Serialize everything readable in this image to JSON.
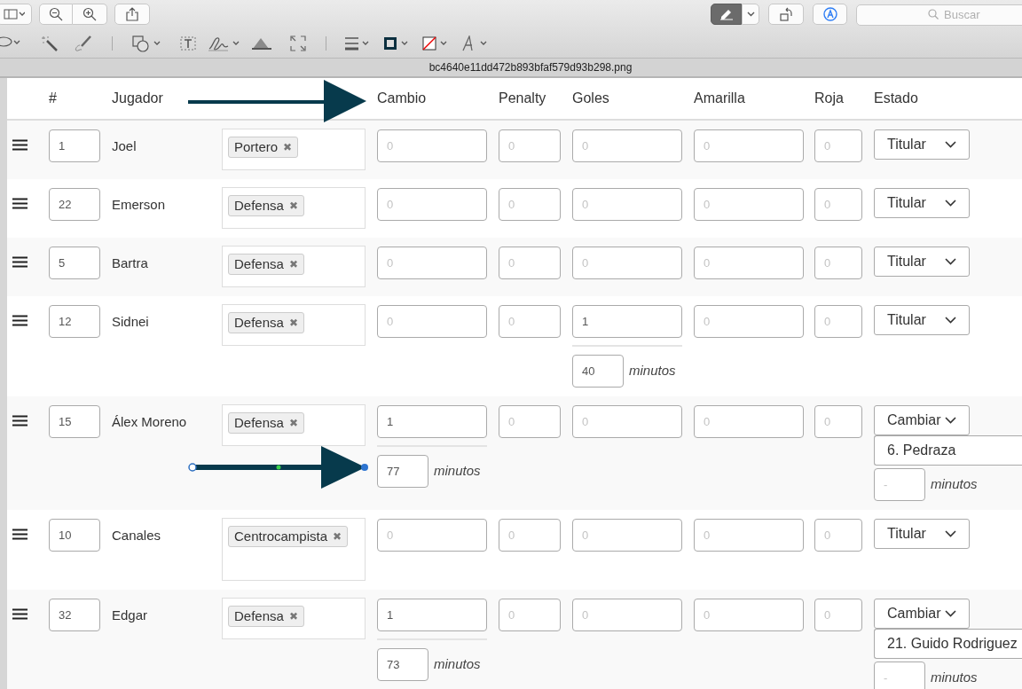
{
  "window": {
    "title": "bc4640e11dd472b893bfaf579d93b298.png"
  },
  "search": {
    "placeholder": "Buscar"
  },
  "table": {
    "columns": [
      "#",
      "Jugador",
      "Cambio",
      "Penalty",
      "Goles",
      "Amarilla",
      "Roja",
      "Estado"
    ],
    "rows": [
      {
        "number": "1",
        "player": "Joel",
        "position": "Portero",
        "remove": "✖",
        "stats": [
          {
            "placeholder": "0"
          },
          {
            "placeholder": "0"
          },
          {
            "placeholder": "0"
          },
          {
            "placeholder": "0"
          },
          {
            "placeholder": "0"
          }
        ],
        "status": {
          "value": "Titular"
        }
      },
      {
        "number": "22",
        "player": "Emerson",
        "position": "Defensa",
        "remove": "✖",
        "stats": [
          {
            "placeholder": "0"
          },
          {
            "placeholder": "0"
          },
          {
            "placeholder": "0"
          },
          {
            "placeholder": "0"
          },
          {
            "placeholder": "0"
          }
        ],
        "status": {
          "value": "Titular"
        }
      },
      {
        "number": "5",
        "player": "Bartra",
        "position": "Defensa",
        "remove": "✖",
        "stats": [
          {
            "placeholder": "0"
          },
          {
            "placeholder": "0"
          },
          {
            "placeholder": "0"
          },
          {
            "placeholder": "0"
          },
          {
            "placeholder": "0"
          }
        ],
        "status": {
          "value": "Titular"
        }
      },
      {
        "number": "12",
        "player": "Sidnei",
        "position": "Defensa",
        "remove": "✖",
        "stats": [
          {
            "placeholder": "0"
          },
          {
            "placeholder": "0"
          },
          {
            "value": "1",
            "minutes": "40",
            "minutes_label": "minutos"
          },
          {
            "placeholder": "0"
          },
          {
            "placeholder": "0"
          }
        ],
        "status": {
          "value": "Titular"
        }
      },
      {
        "number": "15",
        "player": "Álex Moreno",
        "position": "Defensa",
        "remove": "✖",
        "stats": [
          {
            "value": "1",
            "minutes": "77",
            "minutes_label": "minutos"
          },
          {
            "placeholder": "0"
          },
          {
            "placeholder": "0"
          },
          {
            "placeholder": "0"
          },
          {
            "placeholder": "0"
          }
        ],
        "status": {
          "value": "Cambiar",
          "substitute": "6. Pedraza",
          "minutes_placeholder": "-",
          "minutes_label": "minutos"
        }
      },
      {
        "number": "10",
        "player": "Canales",
        "position": "Centrocampista",
        "remove": "✖",
        "stats": [
          {
            "placeholder": "0"
          },
          {
            "placeholder": "0"
          },
          {
            "placeholder": "0"
          },
          {
            "placeholder": "0"
          },
          {
            "placeholder": "0"
          }
        ],
        "status": {
          "value": "Titular"
        }
      },
      {
        "number": "32",
        "player": "Edgar",
        "position": "Defensa",
        "remove": "✖",
        "stats": [
          {
            "value": "1",
            "minutes": "73",
            "minutes_label": "minutos"
          },
          {
            "placeholder": "0"
          },
          {
            "placeholder": "0"
          },
          {
            "placeholder": "0"
          },
          {
            "placeholder": "0"
          }
        ],
        "status": {
          "value": "Cambiar",
          "substitute": "21. Guido Rodriguez",
          "minutes_placeholder": "-",
          "minutes_label": "minutos"
        }
      }
    ]
  }
}
